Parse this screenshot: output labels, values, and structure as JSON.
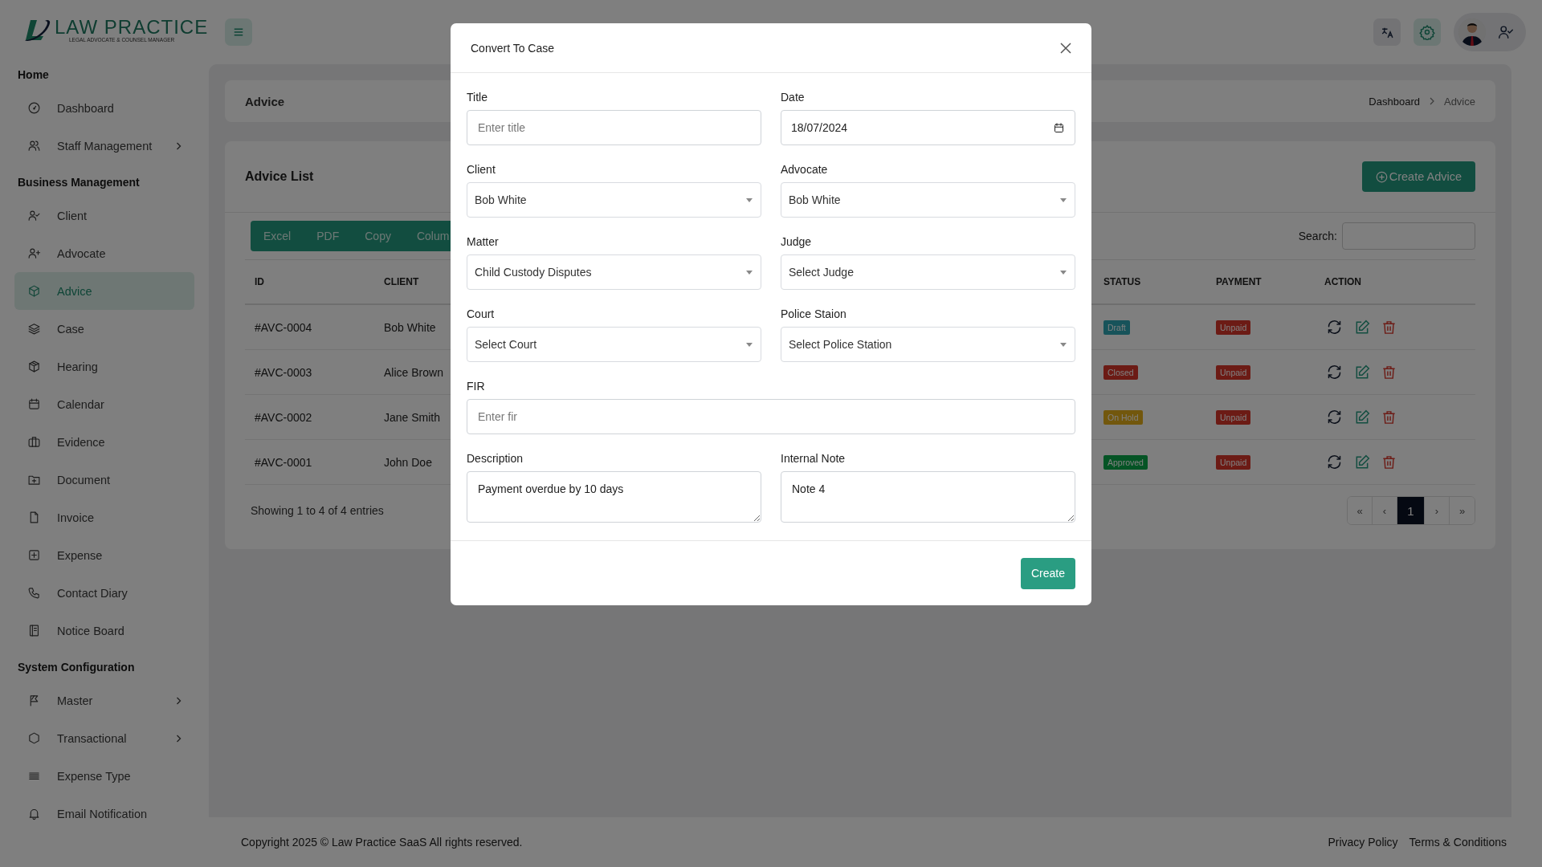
{
  "logo": {
    "name": "LAW PRACTICE",
    "tagline": "LEGAL ADVOCATE & COUNSEL MANAGER"
  },
  "sidebar": {
    "sections": [
      {
        "title": "Home",
        "items": [
          {
            "label": "Dashboard",
            "selected": false,
            "expandable": false
          },
          {
            "label": "Staff Management",
            "selected": false,
            "expandable": true
          }
        ]
      },
      {
        "title": "Business Management",
        "items": [
          {
            "label": "Client",
            "selected": false,
            "expandable": false
          },
          {
            "label": "Advocate",
            "selected": false,
            "expandable": false
          },
          {
            "label": "Advice",
            "selected": true,
            "expandable": false
          },
          {
            "label": "Case",
            "selected": false,
            "expandable": false
          },
          {
            "label": "Hearing",
            "selected": false,
            "expandable": false
          },
          {
            "label": "Calendar",
            "selected": false,
            "expandable": false
          },
          {
            "label": "Evidence",
            "selected": false,
            "expandable": false
          },
          {
            "label": "Document",
            "selected": false,
            "expandable": false
          },
          {
            "label": "Invoice",
            "selected": false,
            "expandable": false
          },
          {
            "label": "Expense",
            "selected": false,
            "expandable": false
          },
          {
            "label": "Contact Diary",
            "selected": false,
            "expandable": false
          },
          {
            "label": "Notice Board",
            "selected": false,
            "expandable": false
          }
        ]
      },
      {
        "title": "System Configuration",
        "items": [
          {
            "label": "Master",
            "selected": false,
            "expandable": true
          },
          {
            "label": "Transactional",
            "selected": false,
            "expandable": true
          },
          {
            "label": "Expense Type",
            "selected": false,
            "expandable": false
          },
          {
            "label": "Email Notification",
            "selected": false,
            "expandable": false
          }
        ]
      }
    ]
  },
  "page_header": {
    "title": "Advice",
    "breadcrumb": [
      "Dashboard",
      "Advice"
    ]
  },
  "advice_list": {
    "title": "Advice List",
    "create_button": "Create Advice",
    "export_buttons": [
      "Excel",
      "PDF",
      "Copy",
      "Colum"
    ],
    "search_label": "Search:",
    "columns": [
      "ID",
      "CLIENT",
      "STATUS",
      "PAYMENT",
      "ACTION"
    ],
    "rows": [
      {
        "id": "#AVC-0004",
        "client": "Bob White",
        "status": {
          "text": "Draft",
          "color": "#17535a"
        },
        "payment": {
          "text": "Unpaid",
          "color": "#6c1b15"
        }
      },
      {
        "id": "#AVC-0003",
        "client": "Alice Brown",
        "status": {
          "text": "Closed",
          "color": "#6c1b15"
        },
        "payment": {
          "text": "Unpaid",
          "color": "#6c1b15"
        }
      },
      {
        "id": "#AVC-0002",
        "client": "Jane Smith",
        "status": {
          "text": "On Hold",
          "color": "#72570d"
        },
        "payment": {
          "text": "Unpaid",
          "color": "#6c1b15"
        }
      },
      {
        "id": "#AVC-0001",
        "client": "John Doe",
        "status": {
          "text": "Approved",
          "color": "#055425"
        },
        "payment": {
          "text": "Unpaid",
          "color": "#6c1b15"
        }
      }
    ],
    "entries_info": "Showing 1 to 4 of 4 entries",
    "pagination": [
      {
        "label": "«",
        "selected": false
      },
      {
        "label": "‹",
        "selected": false
      },
      {
        "label": "1",
        "selected": true
      },
      {
        "label": "›",
        "selected": false
      },
      {
        "label": "»",
        "selected": false
      }
    ]
  },
  "footer": {
    "copyright": "Copyright 2025 © Law Practice SaaS All rights reserved.",
    "links": [
      "Privacy Policy",
      "Terms & Conditions"
    ]
  },
  "modal": {
    "title": "Convert To Case",
    "rows": [
      [
        {
          "kind": "text",
          "label": "Title",
          "placeholder": "Enter title"
        },
        {
          "kind": "date",
          "label": "Date",
          "value": "18/07/2024"
        }
      ],
      [
        {
          "kind": "select",
          "label": "Client",
          "value": "Bob White"
        },
        {
          "kind": "select",
          "label": "Advocate",
          "value": "Bob White"
        }
      ],
      [
        {
          "kind": "select",
          "label": "Matter",
          "value": "Child Custody Disputes"
        },
        {
          "kind": "select",
          "label": "Judge",
          "value": "Select Judge"
        }
      ],
      [
        {
          "kind": "select",
          "label": "Court",
          "value": "Select Court"
        },
        {
          "kind": "select",
          "label": "Police Staion",
          "value": "Select Police Station"
        }
      ],
      [
        {
          "kind": "text",
          "label": "FIR",
          "placeholder": "Enter fir"
        }
      ],
      [
        {
          "kind": "textarea",
          "label": "Description",
          "value": "Payment overdue by 10 days"
        },
        {
          "kind": "textarea",
          "label": "Internal Note",
          "value": "Note 4"
        }
      ]
    ],
    "submit": "Create"
  }
}
